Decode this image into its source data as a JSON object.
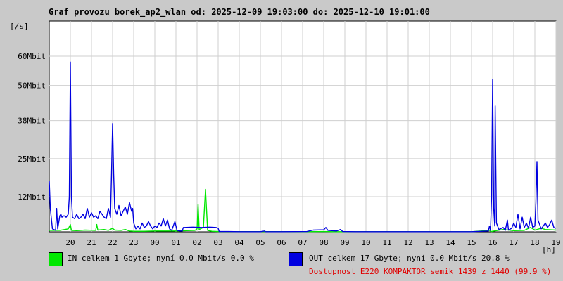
{
  "colors": {
    "in": "#00e800",
    "out": "#0000e0",
    "grid": "#cfcfcf",
    "plot_bg": "#ffffff",
    "availability": "#e00000"
  },
  "legend": {
    "in_text": "IN celkem 1 Gbyte; nyní   0.0 Mbit/s 0.0 %",
    "out_text": "OUT celkem 17 Gbyte; nyní   0.0 Mbit/s 20.8 %",
    "availability_text": "Dostupnost E220 KOMPAKTOR semik 1439 z 1440 (99.9 %)"
  },
  "chart_data": {
    "type": "line",
    "title": "Graf provozu borek_ap2_wlan od: 2025-12-09 19:03:00 do: 2025-12-10 19:01:00",
    "ylabel": "[/s]",
    "xlabel": "[h]",
    "xlim": [
      0,
      24
    ],
    "ylim": [
      0,
      72
    ],
    "grid": true,
    "y_ticks": [
      {
        "value": 12,
        "label": "12Mbit"
      },
      {
        "value": 25,
        "label": "25Mbit"
      },
      {
        "value": 38,
        "label": "38Mbit"
      },
      {
        "value": 50,
        "label": "50Mbit"
      },
      {
        "value": 60,
        "label": "60Mbit"
      }
    ],
    "x_ticks": [
      {
        "value": 1,
        "label": "20"
      },
      {
        "value": 2,
        "label": "21"
      },
      {
        "value": 3,
        "label": "22"
      },
      {
        "value": 4,
        "label": "23"
      },
      {
        "value": 5,
        "label": "00"
      },
      {
        "value": 6,
        "label": "01"
      },
      {
        "value": 7,
        "label": "02"
      },
      {
        "value": 8,
        "label": "03"
      },
      {
        "value": 9,
        "label": "04"
      },
      {
        "value": 10,
        "label": "05"
      },
      {
        "value": 11,
        "label": "06"
      },
      {
        "value": 12,
        "label": "07"
      },
      {
        "value": 13,
        "label": "08"
      },
      {
        "value": 14,
        "label": "09"
      },
      {
        "value": 15,
        "label": "10"
      },
      {
        "value": 16,
        "label": "11"
      },
      {
        "value": 17,
        "label": "12"
      },
      {
        "value": 18,
        "label": "13"
      },
      {
        "value": 19,
        "label": "14"
      },
      {
        "value": 20,
        "label": "15"
      },
      {
        "value": 21,
        "label": "16"
      },
      {
        "value": 22,
        "label": "17"
      },
      {
        "value": 23,
        "label": "18"
      },
      {
        "value": 24,
        "label": "19"
      }
    ],
    "series": [
      {
        "name": "IN",
        "color": "#00e800",
        "points": [
          [
            0,
            0.5
          ],
          [
            0.5,
            0.5
          ],
          [
            0.9,
            1.0
          ],
          [
            1.0,
            2.5
          ],
          [
            1.05,
            0.5
          ],
          [
            1.3,
            0.4
          ],
          [
            1.7,
            0.6
          ],
          [
            2.2,
            0.5
          ],
          [
            2.25,
            2.5
          ],
          [
            2.3,
            0.6
          ],
          [
            2.6,
            0.8
          ],
          [
            2.8,
            0.5
          ],
          [
            3.0,
            1.2
          ],
          [
            3.1,
            0.6
          ],
          [
            3.4,
            0.5
          ],
          [
            3.6,
            0.8
          ],
          [
            3.8,
            0.3
          ],
          [
            4.0,
            0.2
          ],
          [
            4.5,
            0.2
          ],
          [
            5.0,
            0.3
          ],
          [
            6.0,
            0.3
          ],
          [
            6.9,
            0.5
          ],
          [
            7.0,
            1.0
          ],
          [
            7.05,
            9.5
          ],
          [
            7.1,
            0.8
          ],
          [
            7.3,
            1.5
          ],
          [
            7.4,
            14.5
          ],
          [
            7.5,
            0.5
          ],
          [
            7.7,
            0.2
          ],
          [
            8.0,
            0.1
          ],
          [
            12,
            0.05
          ],
          [
            13,
            0.1
          ],
          [
            13.5,
            0.05
          ],
          [
            16,
            0.05
          ],
          [
            20,
            0.05
          ],
          [
            20.85,
            0.5
          ],
          [
            20.95,
            0.1
          ],
          [
            21,
            0.2
          ],
          [
            21.5,
            0.8
          ],
          [
            22,
            0.4
          ],
          [
            22.5,
            0.5
          ],
          [
            22.8,
            1.5
          ],
          [
            23,
            0.6
          ],
          [
            23.3,
            1.2
          ],
          [
            23.5,
            0.8
          ],
          [
            24,
            0.6
          ]
        ]
      },
      {
        "name": "OUT",
        "color": "#0000e0",
        "points": [
          [
            0,
            17.5
          ],
          [
            0.05,
            8
          ],
          [
            0.15,
            1
          ],
          [
            0.3,
            0.5
          ],
          [
            0.35,
            8
          ],
          [
            0.4,
            1
          ],
          [
            0.5,
            5.5
          ],
          [
            0.55,
            6
          ],
          [
            0.6,
            5
          ],
          [
            0.7,
            5.5
          ],
          [
            0.8,
            5
          ],
          [
            0.9,
            6
          ],
          [
            0.95,
            12
          ],
          [
            1.0,
            58
          ],
          [
            1.05,
            12
          ],
          [
            1.1,
            5
          ],
          [
            1.2,
            4.5
          ],
          [
            1.3,
            6
          ],
          [
            1.4,
            4.5
          ],
          [
            1.5,
            5
          ],
          [
            1.6,
            6
          ],
          [
            1.7,
            4.5
          ],
          [
            1.8,
            8
          ],
          [
            1.9,
            5
          ],
          [
            2.0,
            6.5
          ],
          [
            2.1,
            5
          ],
          [
            2.2,
            5.5
          ],
          [
            2.3,
            4.5
          ],
          [
            2.4,
            7
          ],
          [
            2.5,
            6
          ],
          [
            2.6,
            5
          ],
          [
            2.7,
            4.5
          ],
          [
            2.8,
            8
          ],
          [
            2.9,
            5
          ],
          [
            2.95,
            20
          ],
          [
            3.0,
            37
          ],
          [
            3.05,
            20
          ],
          [
            3.1,
            8
          ],
          [
            3.2,
            6
          ],
          [
            3.3,
            9
          ],
          [
            3.4,
            5.5
          ],
          [
            3.5,
            7
          ],
          [
            3.6,
            8.5
          ],
          [
            3.7,
            6
          ],
          [
            3.8,
            10
          ],
          [
            3.9,
            7
          ],
          [
            3.95,
            8
          ],
          [
            4.0,
            3
          ],
          [
            4.1,
            1
          ],
          [
            4.2,
            2
          ],
          [
            4.3,
            1
          ],
          [
            4.4,
            3
          ],
          [
            4.5,
            1.5
          ],
          [
            4.6,
            2
          ],
          [
            4.7,
            3.5
          ],
          [
            4.8,
            2
          ],
          [
            4.9,
            1
          ],
          [
            5.0,
            2
          ],
          [
            5.1,
            1.5
          ],
          [
            5.2,
            3
          ],
          [
            5.3,
            2
          ],
          [
            5.4,
            4.5
          ],
          [
            5.5,
            2
          ],
          [
            5.6,
            4
          ],
          [
            5.7,
            1
          ],
          [
            5.8,
            0.5
          ],
          [
            5.95,
            3.5
          ],
          [
            6.05,
            0.5
          ],
          [
            6.2,
            0.3
          ],
          [
            6.3,
            0.3
          ],
          [
            6.35,
            1.5
          ],
          [
            6.4,
            1.5
          ],
          [
            6.8,
            1.6
          ],
          [
            7.2,
            1.5
          ],
          [
            7.6,
            1.6
          ],
          [
            7.9,
            1.5
          ],
          [
            8.0,
            1.2
          ],
          [
            8.05,
            0.1
          ],
          [
            8.5,
            0.1
          ],
          [
            9.0,
            0.05
          ],
          [
            10.0,
            0.05
          ],
          [
            10.2,
            0.3
          ],
          [
            10.25,
            0.05
          ],
          [
            11.0,
            0.05
          ],
          [
            12.2,
            0.1
          ],
          [
            12.5,
            0.6
          ],
          [
            13.0,
            0.7
          ],
          [
            13.1,
            1.5
          ],
          [
            13.2,
            0.5
          ],
          [
            13.6,
            0.3
          ],
          [
            13.8,
            0.8
          ],
          [
            13.9,
            0.1
          ],
          [
            14.5,
            0.05
          ],
          [
            16,
            0.05
          ],
          [
            20,
            0.05
          ],
          [
            20.8,
            0.3
          ],
          [
            20.85,
            2
          ],
          [
            20.9,
            0.5
          ],
          [
            20.95,
            12
          ],
          [
            21.0,
            52
          ],
          [
            21.05,
            8
          ],
          [
            21.1,
            2
          ],
          [
            21.12,
            43
          ],
          [
            21.18,
            3
          ],
          [
            21.3,
            0.8
          ],
          [
            21.5,
            1.5
          ],
          [
            21.6,
            0.5
          ],
          [
            21.7,
            4
          ],
          [
            21.75,
            0.6
          ],
          [
            21.9,
            1.2
          ],
          [
            22.0,
            3
          ],
          [
            22.1,
            1.5
          ],
          [
            22.2,
            6
          ],
          [
            22.3,
            1
          ],
          [
            22.4,
            5
          ],
          [
            22.5,
            1.5
          ],
          [
            22.6,
            3
          ],
          [
            22.7,
            1.2
          ],
          [
            22.8,
            5
          ],
          [
            22.9,
            1.5
          ],
          [
            23.0,
            2
          ],
          [
            23.05,
            10
          ],
          [
            23.1,
            24
          ],
          [
            23.15,
            4
          ],
          [
            23.3,
            1
          ],
          [
            23.4,
            2
          ],
          [
            23.5,
            3
          ],
          [
            23.6,
            1.5
          ],
          [
            23.7,
            2.5
          ],
          [
            23.8,
            4
          ],
          [
            23.9,
            1.5
          ],
          [
            24,
            1.2
          ]
        ]
      }
    ]
  }
}
